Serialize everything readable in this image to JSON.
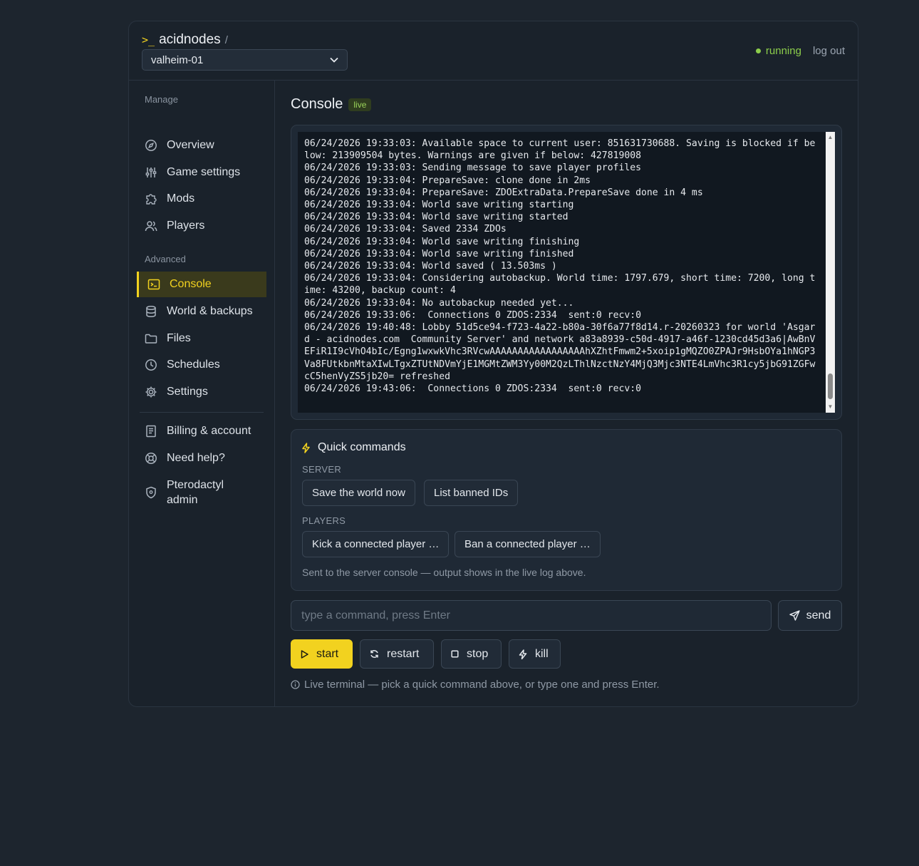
{
  "brand": {
    "prompt": ">_",
    "name": "acidnodes",
    "separator": "/"
  },
  "server_select": {
    "value": "valheim-01"
  },
  "status": {
    "state": "running",
    "logout": "log out"
  },
  "sidebar": {
    "manage_label": "Manage",
    "advanced_label": "Advanced",
    "manage_items": [
      {
        "label": "Overview",
        "icon": "compass-icon"
      },
      {
        "label": "Game settings",
        "icon": "sliders-icon"
      },
      {
        "label": "Mods",
        "icon": "puzzle-icon"
      },
      {
        "label": "Players",
        "icon": "users-icon"
      }
    ],
    "advanced_items": [
      {
        "label": "Console",
        "icon": "terminal-icon",
        "active": true
      },
      {
        "label": "World & backups",
        "icon": "database-icon"
      },
      {
        "label": "Files",
        "icon": "folder-icon"
      },
      {
        "label": "Schedules",
        "icon": "clock-icon"
      },
      {
        "label": "Settings",
        "icon": "gear-icon"
      }
    ],
    "account_items": [
      {
        "label": "Billing & account",
        "icon": "receipt-icon"
      },
      {
        "label": "Need help?",
        "icon": "lifebuoy-icon"
      },
      {
        "label": "Pterodactyl admin",
        "icon": "shield-icon"
      }
    ]
  },
  "console": {
    "title": "Console",
    "badge": "live",
    "log": "06/24/2026 19:33:03: Available space to current user: 851631730688. Saving is blocked if below: 213909504 bytes. Warnings are given if below: 427819008\n06/24/2026 19:33:03: Sending message to save player profiles\n06/24/2026 19:33:04: PrepareSave: clone done in 2ms\n06/24/2026 19:33:04: PrepareSave: ZDOExtraData.PrepareSave done in 4 ms\n06/24/2026 19:33:04: World save writing starting\n06/24/2026 19:33:04: World save writing started\n06/24/2026 19:33:04: Saved 2334 ZDOs\n06/24/2026 19:33:04: World save writing finishing\n06/24/2026 19:33:04: World save writing finished\n06/24/2026 19:33:04: World saved ( 13.503ms )\n06/24/2026 19:33:04: Considering autobackup. World time: 1797.679, short time: 7200, long time: 43200, backup count: 4\n06/24/2026 19:33:04: No autobackup needed yet...\n06/24/2026 19:33:06:  Connections 0 ZDOS:2334  sent:0 recv:0\n06/24/2026 19:40:48: Lobby 51d5ce94-f723-4a22-b80a-30f6a77f8d14.r-20260323 for world 'Asgard - acidnodes.com  Community Server' and network a83a8939-c50d-4917-a46f-1230cd45d3a6|AwBnVEFiR1I9cVhO4bIc/Egng1wxwkVhc3RVcwAAAAAAAAAAAAAAAAAhXZhtFmwm2+5xoip1gMQZO0ZPAJr9HsbOYa1hNGP3Va8FUtkbnMtaXIwLTgxZTUtNDVmYjE1MGMtZWM3Yy00M2QzLThlNzctNzY4MjQ3Mjc3NTE4LmVhc3R1cy5jbG91ZGFwcC5henVyZS5jb20= refreshed\n06/24/2026 19:43:06:  Connections 0 ZDOS:2334  sent:0 recv:0"
  },
  "quick_commands": {
    "title": "Quick commands",
    "server_label": "SERVER",
    "players_label": "PLAYERS",
    "server_buttons": [
      "Save the world now",
      "List banned IDs"
    ],
    "player_buttons": [
      "Kick a connected player …",
      "Ban a connected player …"
    ],
    "note": "Sent to the server console — output shows in the live log above."
  },
  "command_input": {
    "placeholder": "type a command, press Enter",
    "value": ""
  },
  "send_label": "send",
  "controls": {
    "start": "start",
    "restart": "restart",
    "stop": "stop",
    "kill": "kill"
  },
  "hint": "Live terminal — pick a quick command above, or type one and press Enter.",
  "colors": {
    "accent": "#f2d21f",
    "running": "#8ccd4b",
    "background": "#1d252e"
  }
}
